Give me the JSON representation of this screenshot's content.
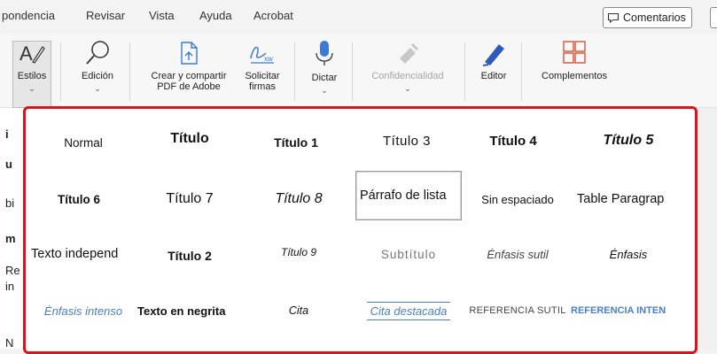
{
  "menu": {
    "tabs": [
      "pondencia",
      "Revisar",
      "Vista",
      "Ayuda",
      "Acrobat"
    ],
    "comments_label": "Comentarios"
  },
  "ribbon": {
    "estilos": {
      "label": "Estilos",
      "icon": "styles-icon"
    },
    "edicion": {
      "label": "Edición",
      "icon": "search-icon"
    },
    "crear_pdf": {
      "label_line1": "Crear y compartir",
      "label_line2": "PDF de Adobe",
      "icon": "pdf-share-icon"
    },
    "solicitar_firmas": {
      "label_line1": "Solicitar",
      "label_line2": "firmas",
      "icon": "signature-icon"
    },
    "dictar": {
      "label": "Dictar",
      "icon": "microphone-icon"
    },
    "confidencialidad": {
      "label": "Confidencialidad",
      "icon": "sensitivity-icon"
    },
    "editor": {
      "label": "Editor",
      "icon": "editor-pen-icon"
    },
    "complementos": {
      "label": "Complementos",
      "icon": "addins-grid-icon"
    }
  },
  "left_strip": {
    "chars": [
      "i",
      "u",
      "bi",
      "m",
      "Re",
      "in",
      "N"
    ]
  },
  "styles": [
    {
      "label": "Normal"
    },
    {
      "label": "Título"
    },
    {
      "label": "Título 1"
    },
    {
      "label": "Título 3"
    },
    {
      "label": "Título 4"
    },
    {
      "label": "Título 5"
    },
    {
      "label": "Título 6"
    },
    {
      "label": "Título 7"
    },
    {
      "label": "Título 8"
    },
    {
      "label": "Párrafo de lista"
    },
    {
      "label": "Sin espaciado"
    },
    {
      "label": "Table Paragrap"
    },
    {
      "label": "Texto independ"
    },
    {
      "label": "Título 2"
    },
    {
      "label": "Título 9"
    },
    {
      "label": "Subtítulo"
    },
    {
      "label": "Énfasis sutil"
    },
    {
      "label": "Énfasis"
    },
    {
      "label": "Énfasis intenso"
    },
    {
      "label": "Texto en negrita"
    },
    {
      "label": "Cita"
    },
    {
      "label": "Cita destacada"
    },
    {
      "label": "REFERENCIA SUTIL"
    },
    {
      "label": "REFERENCIA INTEN"
    }
  ],
  "colors": {
    "highlight_border": "#e0101a",
    "accent_blue": "#4a7fc1"
  }
}
